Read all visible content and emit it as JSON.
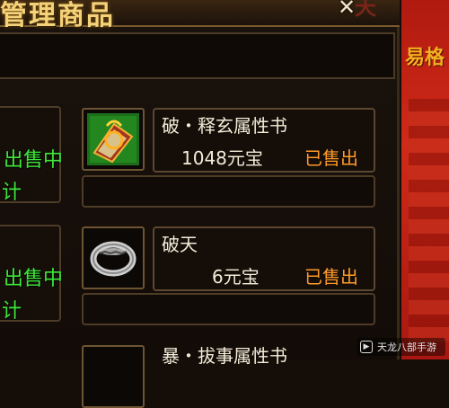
{
  "window": {
    "title": "管理商品",
    "close_icon": "x-close-icon",
    "deco_text": "天"
  },
  "right_panel": {
    "label": "易格"
  },
  "left_column": {
    "rows": [
      {
        "status": "出售中",
        "sub": "计"
      },
      {
        "status": "出售中",
        "sub": "计"
      }
    ]
  },
  "items": [
    {
      "name": "破・释玄属性书",
      "price": "1048元宝",
      "status": "已售出",
      "icon": "attribute-book-icon"
    },
    {
      "name": "破天",
      "price": "6元宝",
      "status": "已售出",
      "icon": "ring-icon"
    }
  ],
  "next_item": {
    "name": "暴・拔事属性书"
  },
  "watermark": {
    "text": "天龙八部手游"
  },
  "colors": {
    "title": "#f4d27a",
    "on_sale": "#3ee83a",
    "sold": "#ff9a2a",
    "text": "#f4ecd8",
    "side_red": "#c4241a"
  }
}
